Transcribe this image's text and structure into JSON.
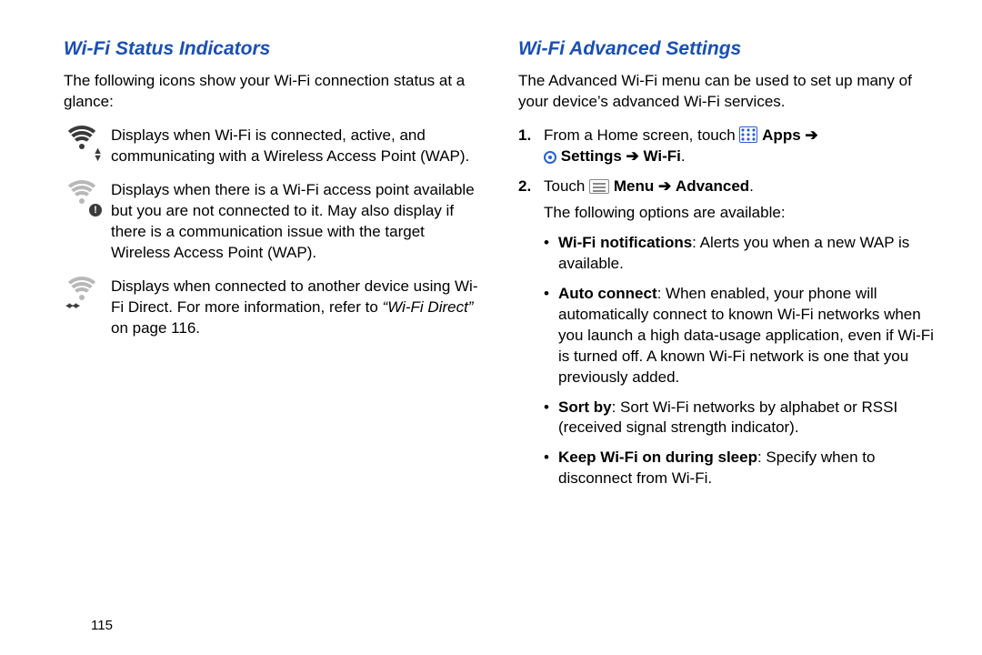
{
  "left": {
    "heading": "Wi-Fi Status Indicators",
    "intro": "The following icons show your Wi-Fi connection status at a glance:",
    "items": [
      {
        "icon": "wifi-active-icon",
        "text": "Displays when Wi-Fi is connected, active, and communicating with a Wireless Access Point (WAP)."
      },
      {
        "icon": "wifi-available-icon",
        "text": "Displays when there is a Wi-Fi access point available but you are not connected to it. May also display if there is a communication issue with the target Wireless Access Point (WAP)."
      },
      {
        "icon": "wifi-direct-icon",
        "text_pre": "Displays when connected to another device using Wi-Fi Direct. For more information, refer to ",
        "text_ref": "“Wi-Fi Direct”",
        "text_post": " on page 116."
      }
    ]
  },
  "right": {
    "heading": "Wi-Fi Advanced Settings",
    "intro": "The Advanced Wi-Fi menu can be used to set up many of your device’s advanced Wi-Fi services.",
    "step1_pre": "From a Home screen, touch ",
    "apps_label": "Apps",
    "arrow": " ➔ ",
    "settings_label": "Settings",
    "wifi_label": "Wi-Fi",
    "period": ".",
    "step2_pre": "Touch ",
    "menu_label": "Menu",
    "advanced_label": "Advanced",
    "options_intro": "The following options are available:",
    "options": [
      {
        "title": "Wi-Fi notifications",
        "desc": ": Alerts you when a new WAP is available."
      },
      {
        "title": "Auto connect",
        "desc": ": When enabled, your phone will automatically connect to known Wi-Fi networks when you launch a high data-usage application, even if Wi-Fi is turned off. A known Wi-Fi network is one that you previously added."
      },
      {
        "title": "Sort by",
        "desc": ": Sort Wi-Fi networks by alphabet or RSSI (received signal strength indicator)."
      },
      {
        "title": "Keep Wi-Fi on during sleep",
        "desc": ": Specify when to disconnect from Wi-Fi."
      }
    ]
  },
  "page_number": "115"
}
